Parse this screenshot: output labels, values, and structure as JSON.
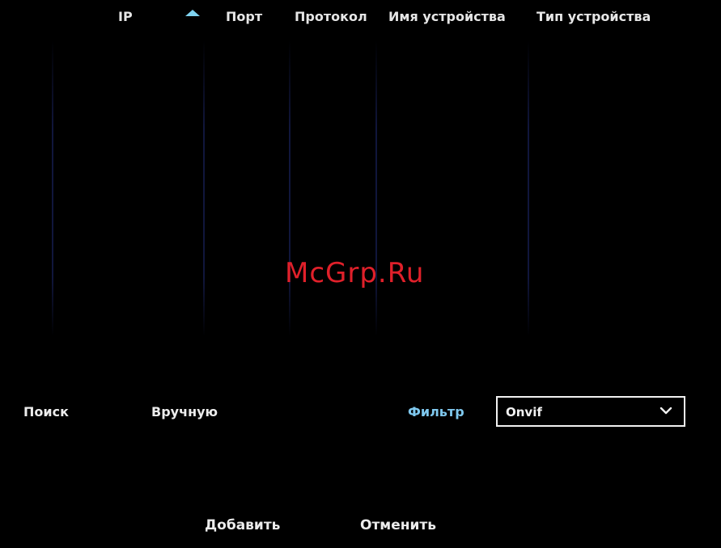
{
  "table": {
    "columns": [
      {
        "label": "IP",
        "sorted": "ascending"
      },
      {
        "label": "Порт"
      },
      {
        "label": "Протокол"
      },
      {
        "label": "Имя устройства"
      },
      {
        "label": "Тип устройства"
      }
    ],
    "rows": []
  },
  "watermark": "McGrp.Ru",
  "controls": {
    "search_label": "Поиск",
    "manual_label": "Вручную",
    "filter_label": "Фильтр",
    "filter_value": "Onvif"
  },
  "footer": {
    "add_label": "Добавить",
    "cancel_label": "Отменить"
  },
  "colors": {
    "background": "#000000",
    "text": "#e8e8e8",
    "accent": "#7fc8ee",
    "watermark": "#e0202a",
    "column_divider": "#1e286e"
  },
  "icons": {
    "sort": "sort-ascending-icon",
    "dropdown": "chevron-down-icon"
  }
}
